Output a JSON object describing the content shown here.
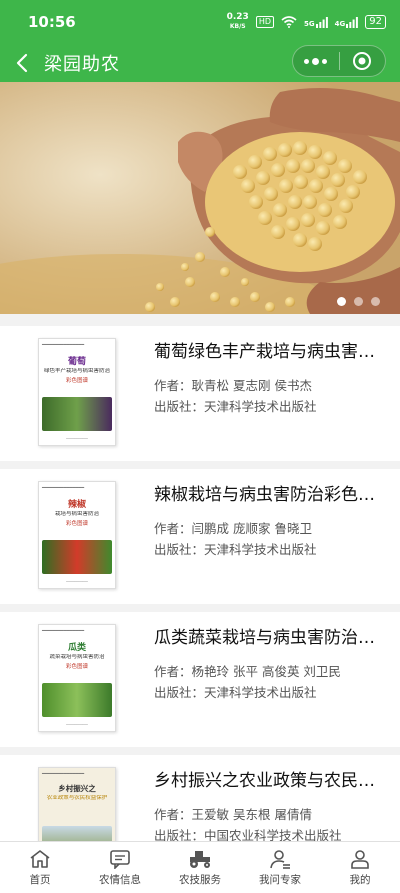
{
  "status_bar": {
    "time": "10:56",
    "net_speed_value": "0.23",
    "net_speed_unit": "KB/S",
    "hd": "HD",
    "signal_1": "5G",
    "signal_2": "4G",
    "battery": "92"
  },
  "nav": {
    "title": "梁园助农"
  },
  "banner": {
    "slide_count": 3,
    "active_slide": 1
  },
  "books": [
    {
      "title": "葡萄绿色丰产栽培与病虫害防治彩色图谱",
      "author": "作者：耿青松 夏志刚 侯书杰",
      "publisher": "出版社：天津科学技术出版社",
      "cover": {
        "crop": "葡萄",
        "subtitle": "绿色丰产栽培与病虫害防治",
        "tag": "彩色图谱",
        "accent": "#6b2c8f",
        "img_color": "#4c7d34"
      }
    },
    {
      "title": "辣椒栽培与病虫害防治彩色图谱",
      "author": "作者：闫鹏成 庞顺家 鲁晓卫",
      "publisher": "出版社：天津科学技术出版社",
      "cover": {
        "crop": "辣椒",
        "subtitle": "栽培与病虫害防治",
        "tag": "彩色图谱",
        "accent": "#c0392b",
        "img_color": "#3f8a2d"
      }
    },
    {
      "title": "瓜类蔬菜栽培与病虫害防治彩色图谱",
      "author": "作者：杨艳玲 张平 高俊英 刘卫民",
      "publisher": "出版社：天津科学技术出版社",
      "cover": {
        "crop": "瓜类",
        "subtitle": "蔬菜栽培与病虫害防治",
        "tag": "彩色图谱",
        "accent": "#2e7d32",
        "img_color": "#5a9e3a"
      }
    },
    {
      "title": "乡村振兴之农业政策与农民权益保护",
      "author": "作者：王爱敏 吴东根 屠倩倩",
      "publisher": "出版社：中国农业科学技术出版社",
      "cover": {
        "crop": "乡村振兴之",
        "subtitle": "农业政策与农民权益保护",
        "tag": "",
        "accent": "#b8860b",
        "img_color": "#7a8f3a"
      }
    }
  ],
  "tabbar": {
    "items": [
      {
        "label": "首页",
        "icon": "home-icon"
      },
      {
        "label": "农情信息",
        "icon": "message-icon"
      },
      {
        "label": "农技服务",
        "icon": "tractor-icon"
      },
      {
        "label": "我问专家",
        "icon": "expert-icon"
      },
      {
        "label": "我的",
        "icon": "user-icon"
      }
    ]
  },
  "colors": {
    "brand_green": "#3eb64a",
    "text_primary": "#111111",
    "text_secondary": "#555555"
  }
}
